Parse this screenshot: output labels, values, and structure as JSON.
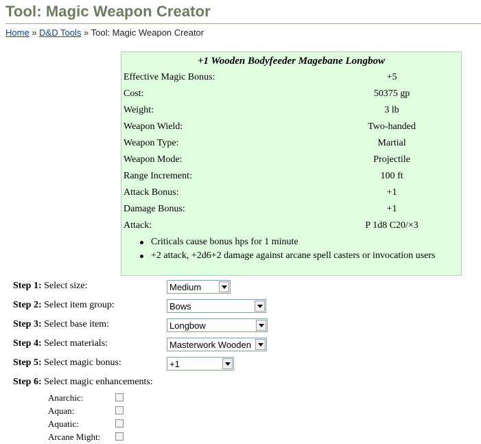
{
  "page": {
    "title": "Tool: Magic Weapon Creator"
  },
  "breadcrumb": {
    "home": "Home",
    "sep1": "»",
    "tools": "D&D Tools",
    "sep2": "»",
    "current": "Tool: Magic Weapon Creator"
  },
  "result": {
    "title": "+1 Wooden Bodyfeeder Magebane Longbow",
    "stats": [
      {
        "label": "Effective Magic Bonus:",
        "value": "+5"
      },
      {
        "label": "Cost:",
        "value": "50375 gp"
      },
      {
        "label": "Weight:",
        "value": "3 lb"
      },
      {
        "label": "Weapon Wield:",
        "value": "Two-handed"
      },
      {
        "label": "Weapon Type:",
        "value": "Martial"
      },
      {
        "label": "Weapon Mode:",
        "value": "Projectile"
      },
      {
        "label": "Range Increment:",
        "value": "100 ft"
      },
      {
        "label": "Attack Bonus:",
        "value": "+1"
      },
      {
        "label": "Damage Bonus:",
        "value": "+1"
      },
      {
        "label": "Attack:",
        "value": "P 1d8 C20/×3"
      }
    ],
    "notes": [
      "Criticals cause bonus hps for 1 minute",
      "+2 attack, +2d6+2 damage against arcane spell casters or invocation users"
    ]
  },
  "steps": [
    {
      "num": "Step 1:",
      "label": "Select size:",
      "value": "Medium"
    },
    {
      "num": "Step 2:",
      "label": "Select item group:",
      "value": "Bows"
    },
    {
      "num": "Step 3:",
      "label": "Select base item:",
      "value": "Longbow"
    },
    {
      "num": "Step 4:",
      "label": "Select materials:",
      "value": "Masterwork Wooden"
    },
    {
      "num": "Step 5:",
      "label": "Select magic bonus:",
      "value": "+1"
    },
    {
      "num": "Step 6:",
      "label": "Select magic enhancements:"
    }
  ],
  "enhancements": [
    "Anarchic:",
    "Aquan:",
    "Aquatic:",
    "Arcane Might:"
  ]
}
